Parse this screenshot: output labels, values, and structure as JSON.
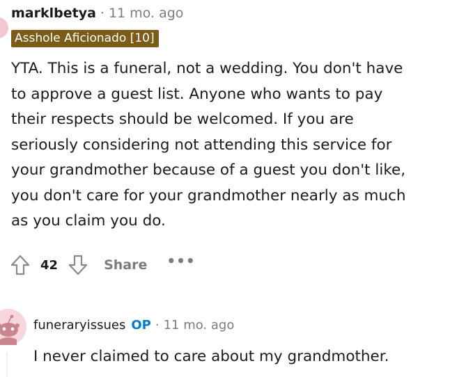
{
  "comment": {
    "username": "marklbetya",
    "separator": "·",
    "time": "11 mo. ago",
    "flair": "Asshole Aficionado [10]",
    "flair_color": "#7a5b17",
    "body_lines": [
      "YTA. This is a funeral, not a wedding. You don't have",
      "to approve a guest list. Anyone who wants to pay",
      "their respects should be welcomed. If you are",
      "seriously considering not attending this service for",
      "your grandmother because of a guest you don't like,",
      "you don't care for your grandmother nearly as much",
      "as you claim you do."
    ],
    "actions": {
      "upvote_icon": "upvote-arrow-icon",
      "vote_count": "42",
      "downvote_icon": "downvote-arrow-icon",
      "share_label": "Share",
      "more_label": "•••"
    }
  },
  "reply": {
    "avatar_icon": "reddit-snoo-avatar-icon",
    "username": "funeraryissues",
    "op_badge": "OP",
    "op_color": "#0079d3",
    "separator": "·",
    "time": "11 mo. ago",
    "body": "I never claimed to care about my grandmother."
  }
}
